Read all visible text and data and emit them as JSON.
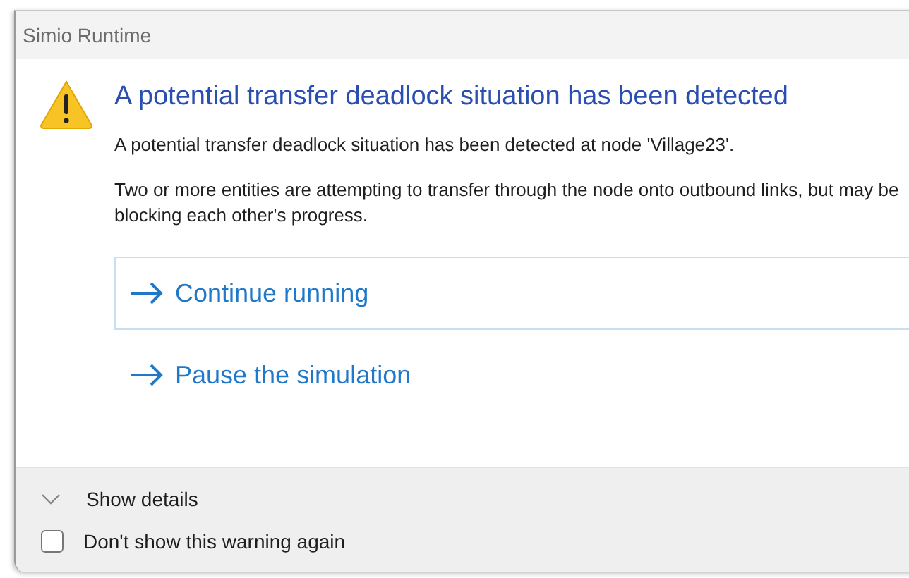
{
  "window": {
    "title": "Simio Runtime"
  },
  "heading": "A potential transfer deadlock situation has been detected",
  "paragraphs": [
    "A potential transfer deadlock situation has been detected at node 'Village23'.",
    "Two or more entities are attempting to transfer through the node onto outbound links, but may be blocking each other's progress."
  ],
  "commands": [
    {
      "label": "Continue running",
      "selected": true
    },
    {
      "label": "Pause the simulation",
      "selected": false
    }
  ],
  "footer": {
    "details": {
      "label": "Show details",
      "expanded": false
    },
    "checkbox": {
      "label": "Don't show this warning again",
      "checked": false
    }
  }
}
